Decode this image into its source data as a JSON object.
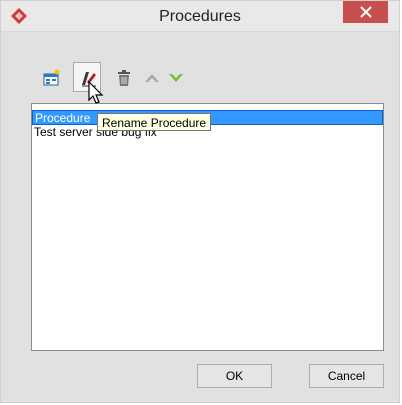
{
  "window": {
    "title": "Procedures"
  },
  "titlebar": {
    "close_icon": "close-icon",
    "app_icon": "red-diamond-icon"
  },
  "toolbar": {
    "buttons": [
      {
        "name": "new-procedure-icon"
      },
      {
        "name": "rename-icon"
      },
      {
        "name": "delete-icon"
      },
      {
        "name": "move-up-icon"
      },
      {
        "name": "move-down-icon"
      }
    ]
  },
  "list": {
    "items": [
      {
        "label": "Procedure",
        "selected": true
      },
      {
        "label": "Test server side bug fix",
        "selected": false
      }
    ]
  },
  "tooltip": {
    "text": "Rename Procedure"
  },
  "footer": {
    "ok_label": "OK",
    "cancel_label": "Cancel"
  },
  "colors": {
    "selection": "#3399ff",
    "close_button": "#c7504c",
    "move_down": "#6ac12b"
  }
}
